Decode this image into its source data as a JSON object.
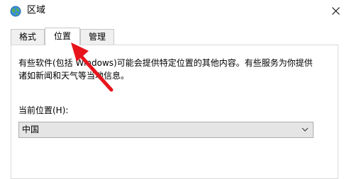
{
  "window": {
    "title": "区域"
  },
  "tabs": [
    {
      "label": "格式"
    },
    {
      "label": "位置",
      "active": true
    },
    {
      "label": "管理"
    }
  ],
  "location_tab": {
    "description_lines": [
      "有些软件(包括 Windows)可能会提供特定位置的其他内容。有些服务为你提供",
      "诸如新闻和天气等当地信息。"
    ],
    "current_location_label": "当前位置(H):",
    "current_location_value": "中国"
  },
  "colors": {
    "annotation_arrow": "#e8141b",
    "tab_border": "#c7c7c7",
    "select_bg": "#e5e5e5"
  },
  "icons": {
    "app": "globe-icon",
    "close": "close-icon",
    "dropdown": "chevron-down-icon"
  }
}
